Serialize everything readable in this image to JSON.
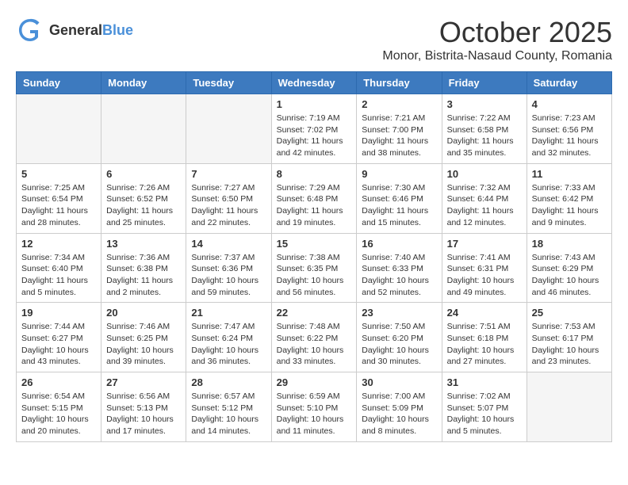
{
  "header": {
    "logo_general": "General",
    "logo_blue": "Blue",
    "month": "October 2025",
    "location": "Monor, Bistrita-Nasaud County, Romania"
  },
  "days_of_week": [
    "Sunday",
    "Monday",
    "Tuesday",
    "Wednesday",
    "Thursday",
    "Friday",
    "Saturday"
  ],
  "weeks": [
    [
      {
        "day": "",
        "info": ""
      },
      {
        "day": "",
        "info": ""
      },
      {
        "day": "",
        "info": ""
      },
      {
        "day": "1",
        "info": "Sunrise: 7:19 AM\nSunset: 7:02 PM\nDaylight: 11 hours and 42 minutes."
      },
      {
        "day": "2",
        "info": "Sunrise: 7:21 AM\nSunset: 7:00 PM\nDaylight: 11 hours and 38 minutes."
      },
      {
        "day": "3",
        "info": "Sunrise: 7:22 AM\nSunset: 6:58 PM\nDaylight: 11 hours and 35 minutes."
      },
      {
        "day": "4",
        "info": "Sunrise: 7:23 AM\nSunset: 6:56 PM\nDaylight: 11 hours and 32 minutes."
      }
    ],
    [
      {
        "day": "5",
        "info": "Sunrise: 7:25 AM\nSunset: 6:54 PM\nDaylight: 11 hours and 28 minutes."
      },
      {
        "day": "6",
        "info": "Sunrise: 7:26 AM\nSunset: 6:52 PM\nDaylight: 11 hours and 25 minutes."
      },
      {
        "day": "7",
        "info": "Sunrise: 7:27 AM\nSunset: 6:50 PM\nDaylight: 11 hours and 22 minutes."
      },
      {
        "day": "8",
        "info": "Sunrise: 7:29 AM\nSunset: 6:48 PM\nDaylight: 11 hours and 19 minutes."
      },
      {
        "day": "9",
        "info": "Sunrise: 7:30 AM\nSunset: 6:46 PM\nDaylight: 11 hours and 15 minutes."
      },
      {
        "day": "10",
        "info": "Sunrise: 7:32 AM\nSunset: 6:44 PM\nDaylight: 11 hours and 12 minutes."
      },
      {
        "day": "11",
        "info": "Sunrise: 7:33 AM\nSunset: 6:42 PM\nDaylight: 11 hours and 9 minutes."
      }
    ],
    [
      {
        "day": "12",
        "info": "Sunrise: 7:34 AM\nSunset: 6:40 PM\nDaylight: 11 hours and 5 minutes."
      },
      {
        "day": "13",
        "info": "Sunrise: 7:36 AM\nSunset: 6:38 PM\nDaylight: 11 hours and 2 minutes."
      },
      {
        "day": "14",
        "info": "Sunrise: 7:37 AM\nSunset: 6:36 PM\nDaylight: 10 hours and 59 minutes."
      },
      {
        "day": "15",
        "info": "Sunrise: 7:38 AM\nSunset: 6:35 PM\nDaylight: 10 hours and 56 minutes."
      },
      {
        "day": "16",
        "info": "Sunrise: 7:40 AM\nSunset: 6:33 PM\nDaylight: 10 hours and 52 minutes."
      },
      {
        "day": "17",
        "info": "Sunrise: 7:41 AM\nSunset: 6:31 PM\nDaylight: 10 hours and 49 minutes."
      },
      {
        "day": "18",
        "info": "Sunrise: 7:43 AM\nSunset: 6:29 PM\nDaylight: 10 hours and 46 minutes."
      }
    ],
    [
      {
        "day": "19",
        "info": "Sunrise: 7:44 AM\nSunset: 6:27 PM\nDaylight: 10 hours and 43 minutes."
      },
      {
        "day": "20",
        "info": "Sunrise: 7:46 AM\nSunset: 6:25 PM\nDaylight: 10 hours and 39 minutes."
      },
      {
        "day": "21",
        "info": "Sunrise: 7:47 AM\nSunset: 6:24 PM\nDaylight: 10 hours and 36 minutes."
      },
      {
        "day": "22",
        "info": "Sunrise: 7:48 AM\nSunset: 6:22 PM\nDaylight: 10 hours and 33 minutes."
      },
      {
        "day": "23",
        "info": "Sunrise: 7:50 AM\nSunset: 6:20 PM\nDaylight: 10 hours and 30 minutes."
      },
      {
        "day": "24",
        "info": "Sunrise: 7:51 AM\nSunset: 6:18 PM\nDaylight: 10 hours and 27 minutes."
      },
      {
        "day": "25",
        "info": "Sunrise: 7:53 AM\nSunset: 6:17 PM\nDaylight: 10 hours and 23 minutes."
      }
    ],
    [
      {
        "day": "26",
        "info": "Sunrise: 6:54 AM\nSunset: 5:15 PM\nDaylight: 10 hours and 20 minutes."
      },
      {
        "day": "27",
        "info": "Sunrise: 6:56 AM\nSunset: 5:13 PM\nDaylight: 10 hours and 17 minutes."
      },
      {
        "day": "28",
        "info": "Sunrise: 6:57 AM\nSunset: 5:12 PM\nDaylight: 10 hours and 14 minutes."
      },
      {
        "day": "29",
        "info": "Sunrise: 6:59 AM\nSunset: 5:10 PM\nDaylight: 10 hours and 11 minutes."
      },
      {
        "day": "30",
        "info": "Sunrise: 7:00 AM\nSunset: 5:09 PM\nDaylight: 10 hours and 8 minutes."
      },
      {
        "day": "31",
        "info": "Sunrise: 7:02 AM\nSunset: 5:07 PM\nDaylight: 10 hours and 5 minutes."
      },
      {
        "day": "",
        "info": ""
      }
    ]
  ]
}
